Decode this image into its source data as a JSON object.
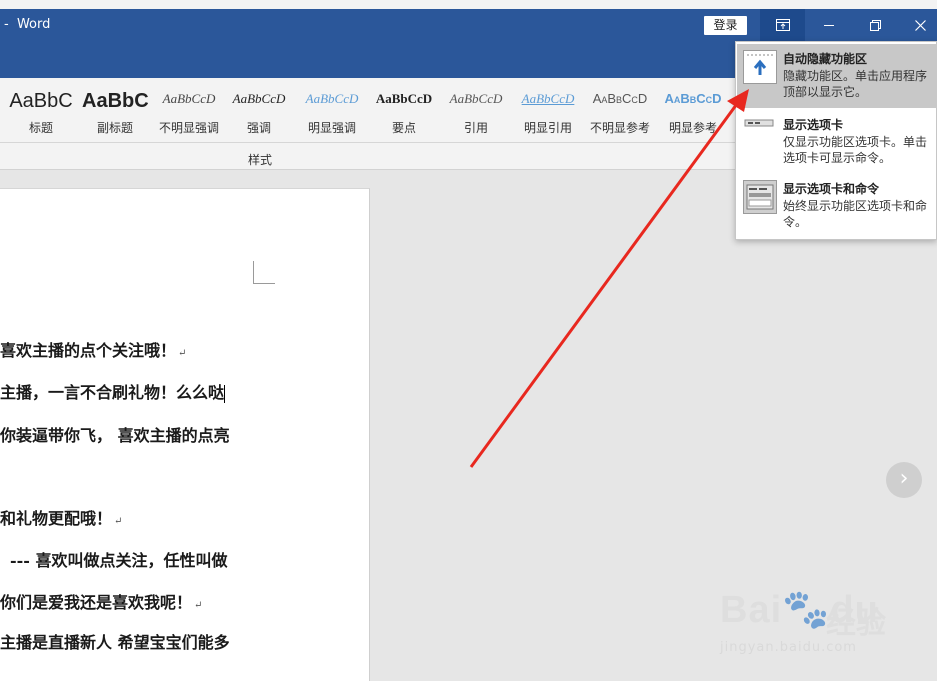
{
  "window": {
    "title": "-  Word",
    "login_label": "登录",
    "min_glyph": "—",
    "restore_glyph": "❐",
    "close_glyph": "✕"
  },
  "ribbon": {
    "group_label": "样式",
    "styles": [
      {
        "sample": "AaBbC",
        "label": "标题",
        "kind": "title"
      },
      {
        "sample": "AaBbC",
        "label": "副标题",
        "kind": "subtitle"
      },
      {
        "sample": "AaBbCcD",
        "label": "不明显强调",
        "kind": "subtle-emphasis"
      },
      {
        "sample": "AaBbCcD",
        "label": "强调",
        "kind": "emphasis"
      },
      {
        "sample": "AaBbCcD",
        "label": "明显强调",
        "kind": "intense-emphasis"
      },
      {
        "sample": "AaBbCcD",
        "label": "要点",
        "kind": "strong"
      },
      {
        "sample": "AaBbCcD",
        "label": "引用",
        "kind": "quote"
      },
      {
        "sample": "AaBbCcD",
        "label": "明显引用",
        "kind": "intense-quote"
      },
      {
        "sample": "AaBbCcD",
        "label": "不明显参考",
        "kind": "subtle-reference"
      },
      {
        "sample": "AaBbCcD",
        "label": "明显参考",
        "kind": "intense-reference"
      }
    ]
  },
  "ribbon_display_menu": {
    "items": [
      {
        "title": "自动隐藏功能区",
        "desc": "隐藏功能区。单击应用程序顶部以显示它。",
        "icon": "auto-hide-ribbon-icon",
        "active": true
      },
      {
        "title": "显示选项卡",
        "desc": "仅显示功能区选项卡。单击选项卡可显示命令。",
        "icon": "show-tabs-icon",
        "active": false
      },
      {
        "title": "显示选项卡和命令",
        "desc": "始终显示功能区选项卡和命令。",
        "icon": "show-tabs-commands-icon",
        "active": false
      }
    ]
  },
  "document": {
    "lines": [
      "喜欢主播的点个关注哦！",
      "主播，一言不合刷礼物！么么哒",
      "你装逼带你飞， 喜欢主播的点亮",
      "和礼物更配哦！",
      "--- 喜欢叫做点关注，任性叫做",
      "你们是爱我还是喜欢我呢！",
      "主播是直播新人 希望宝宝们能多"
    ]
  },
  "nav": {
    "next_glyph": "›"
  },
  "watermark": {
    "brand": "Bai",
    "brand2": "du",
    "cn": "经验",
    "url": "jingyan.baidu.com"
  },
  "colors": {
    "title_bar": "#2b579a",
    "arrow": "#e8281f",
    "menu_active": "#c8c8c8"
  }
}
